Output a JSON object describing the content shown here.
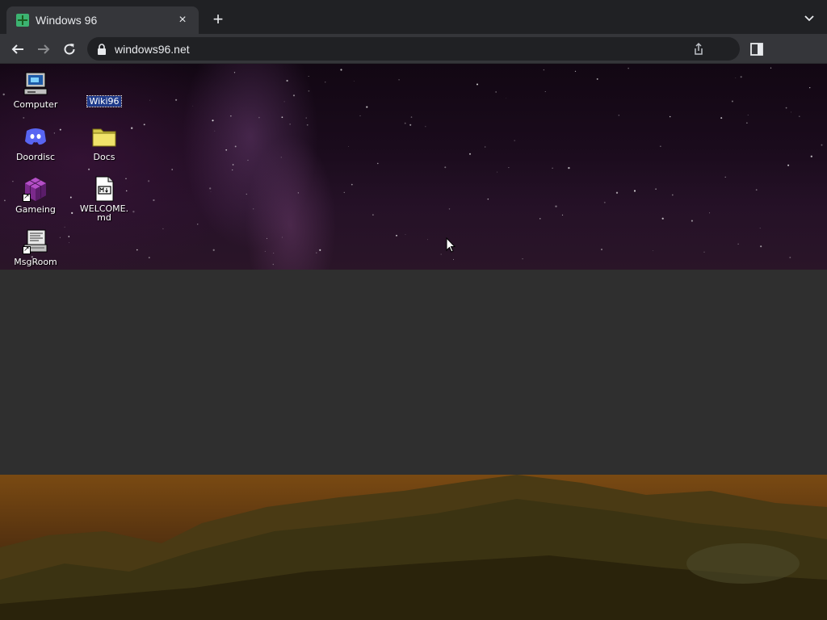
{
  "browser": {
    "tab": {
      "title": "Windows 96",
      "close_glyph": "×"
    },
    "new_tab_glyph": "+",
    "address_bar": {
      "url": "windows96.net"
    }
  },
  "desktop": {
    "icons": [
      {
        "label": "Computer",
        "icon": "computer-icon"
      },
      {
        "label": "Wiki96",
        "icon": "wiki-icon",
        "selected": true
      },
      {
        "label": "Doordisc",
        "icon": "discord-icon"
      },
      {
        "label": "Docs",
        "icon": "folder-icon"
      },
      {
        "label": "Gameing",
        "icon": "game-cube-icon"
      },
      {
        "label": "WELCOME.md",
        "icon": "markdown-file-icon"
      },
      {
        "label": "MsgRoom",
        "icon": "msgroom-icon"
      }
    ]
  },
  "colors": {
    "chrome_bg": "#202124",
    "toolbar_bg": "#35363a",
    "selection": "#1e3a8a",
    "desktop_gray": "#2f2f2f"
  }
}
